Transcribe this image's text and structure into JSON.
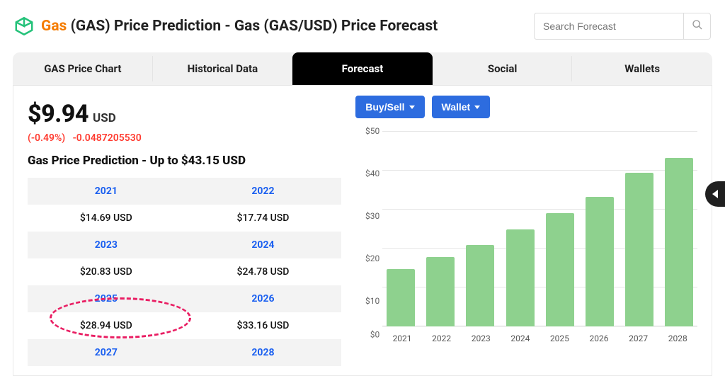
{
  "header": {
    "coin_name": "Gas",
    "title_rest": "(GAS) Price Prediction - Gas (GAS/USD) Price Forecast"
  },
  "search": {
    "placeholder": "Search Forecast"
  },
  "tabs": [
    {
      "label": "GAS Price Chart",
      "active": false
    },
    {
      "label": "Historical Data",
      "active": false
    },
    {
      "label": "Forecast",
      "active": true
    },
    {
      "label": "Social",
      "active": false
    },
    {
      "label": "Wallets",
      "active": false
    }
  ],
  "price": {
    "amount": "$9.94",
    "currency": "USD",
    "change_pct": "(-0.49%)",
    "change_abs": "-0.0487205530"
  },
  "prediction_title": "Gas Price Prediction - Up to $43.15 USD",
  "prediction_table": [
    {
      "year": "2021",
      "value": "$14.69 USD"
    },
    {
      "year": "2022",
      "value": "$17.74 USD"
    },
    {
      "year": "2023",
      "value": "$20.83 USD"
    },
    {
      "year": "2024",
      "value": "$24.78 USD"
    },
    {
      "year": "2025",
      "value": "$28.94 USD"
    },
    {
      "year": "2026",
      "value": "$33.16 USD"
    },
    {
      "year": "2027",
      "value": ""
    },
    {
      "year": "2028",
      "value": ""
    }
  ],
  "buttons": {
    "buysell": "Buy/Sell",
    "wallet": "Wallet"
  },
  "chart_data": {
    "type": "bar",
    "categories": [
      "2021",
      "2022",
      "2023",
      "2024",
      "2025",
      "2026",
      "2027",
      "2028"
    ],
    "values": [
      14.69,
      17.74,
      20.83,
      24.78,
      28.94,
      33.16,
      39.3,
      43.15
    ],
    "ylim": [
      0,
      50
    ],
    "yticks": [
      "$50",
      "$40",
      "$30",
      "$20",
      "$10",
      "$0"
    ],
    "ylabel": "",
    "xlabel": "",
    "title": ""
  },
  "colors": {
    "coin_accent": "#f57c00",
    "link_blue": "#1a5ff0",
    "btn_blue": "#2d6cdf",
    "bar_green": "#8ed18e",
    "negative_red": "#ff3b30",
    "highlight_pink": "#e91e63"
  }
}
